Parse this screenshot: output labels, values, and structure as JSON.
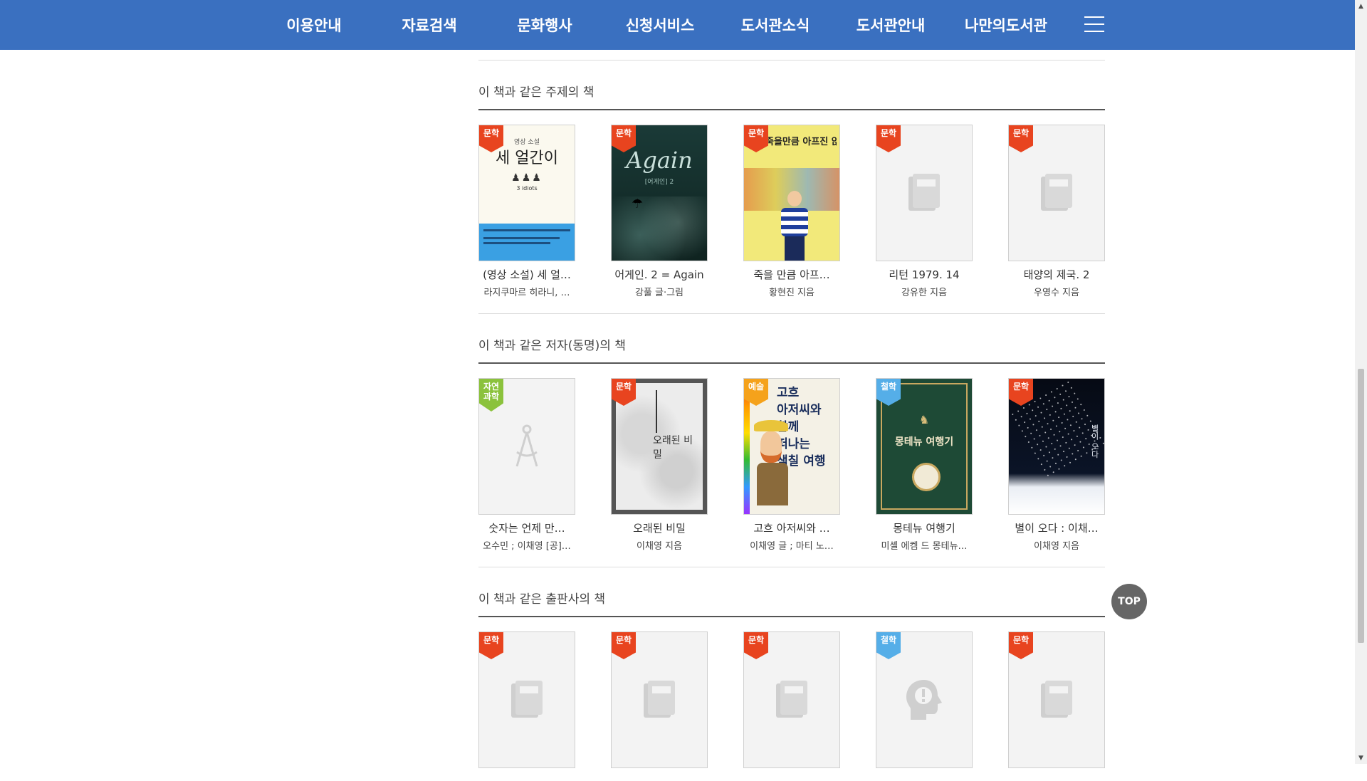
{
  "nav": {
    "items": [
      "이용안내",
      "자료검색",
      "문화행사",
      "신청서비스",
      "도서관소식",
      "도서관안내",
      "나만의도서관"
    ]
  },
  "sections": [
    {
      "title": "이 책과 같은 주제의 책",
      "books": [
        {
          "category": "문학",
          "badge_color": "#e8441f",
          "title": "(영상 소설) 세 얼…",
          "author": "라지쿠마르 히라니, …",
          "cover": "idiots"
        },
        {
          "category": "문학",
          "badge_color": "#e8441f",
          "title": "어게인. 2 = Again",
          "author": "강풀 글·그림",
          "cover": "again"
        },
        {
          "category": "문학",
          "badge_color": "#e8441f",
          "title": "죽을 만큼 아프…",
          "author": "황현진 지음",
          "cover": "pain"
        },
        {
          "category": "문학",
          "badge_color": "#e8441f",
          "title": "리턴 1979. 14",
          "author": "강유한 지음",
          "cover": "placeholder-book"
        },
        {
          "category": "문학",
          "badge_color": "#e8441f",
          "title": "태양의 제국. 2",
          "author": "우영수 지음",
          "cover": "placeholder-book"
        }
      ]
    },
    {
      "title": "이 책과 같은 저자(동명)의 책",
      "books": [
        {
          "category": "자연\n과학",
          "badge_color": "#8bc23c",
          "title": "숫자는 언제 만…",
          "author": "오수민 ; 이채영 [공]…",
          "cover": "placeholder-compass"
        },
        {
          "category": "문학",
          "badge_color": "#e8441f",
          "title": "오래된 비밀",
          "author": "이채영 지음",
          "cover": "secret"
        },
        {
          "category": "예술",
          "badge_color": "#f5a21b",
          "title": "고흐 아저씨와 …",
          "author": "이채영 글 ; 마티 노…",
          "cover": "gogh"
        },
        {
          "category": "철학",
          "badge_color": "#55aee8",
          "title": "몽테뉴 여행기",
          "author": "미셸 에켐 드 몽테뉴…",
          "cover": "montaigne"
        },
        {
          "category": "문학",
          "badge_color": "#e8441f",
          "title": "별이 오다 : 이채…",
          "author": "이채영 지음",
          "cover": "star"
        }
      ]
    },
    {
      "title": "이 책과 같은 출판사의 책",
      "books": [
        {
          "category": "문학",
          "badge_color": "#e8441f",
          "title": "",
          "author": "",
          "cover": "placeholder-book"
        },
        {
          "category": "문학",
          "badge_color": "#e8441f",
          "title": "",
          "author": "",
          "cover": "placeholder-book"
        },
        {
          "category": "문학",
          "badge_color": "#e8441f",
          "title": "",
          "author": "",
          "cover": "placeholder-book"
        },
        {
          "category": "철학",
          "badge_color": "#55aee8",
          "title": "",
          "author": "",
          "cover": "placeholder-head"
        },
        {
          "category": "문학",
          "badge_color": "#e8441f",
          "title": "",
          "author": "",
          "cover": "placeholder-book"
        }
      ]
    }
  ],
  "cover_text": {
    "idiots_top": "영상 소설",
    "idiots_title": "세 얼간이",
    "idiots_sub": "3 idiots",
    "again_title": "Again",
    "again_sub": "[어게인] 2",
    "pain_title": "죽을만큼 아프진 않아",
    "secret_title": "오래된 비밀",
    "gogh_title": "고흐 아저씨와 함께 떠나는 색칠 여행",
    "montaigne_title": "몽테뉴 여행기",
    "star_title": "별이 오다"
  },
  "top_button": "TOP",
  "colors": {
    "nav_bg": "#3a70c0",
    "badge_literature": "#e8441f",
    "badge_science": "#8bc23c",
    "badge_art": "#f5a21b",
    "badge_philosophy": "#55aee8"
  }
}
